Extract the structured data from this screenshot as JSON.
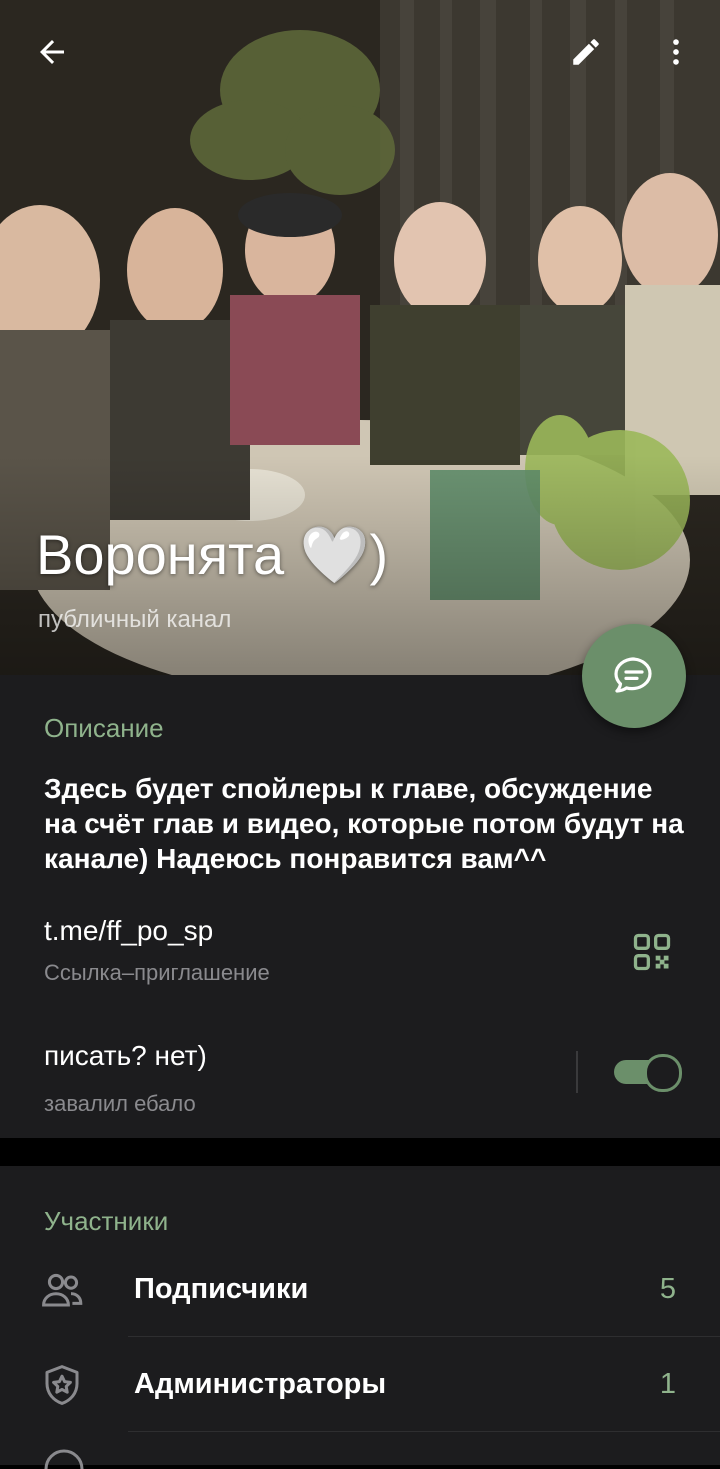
{
  "header": {
    "title": "Воронята 🤍)",
    "subtitle": "публичный канал",
    "back_icon": "arrow-left-icon",
    "edit_icon": "pencil-icon",
    "more_icon": "more-vertical-icon",
    "fab_icon": "chat-bubble-icon"
  },
  "info": {
    "description_header": "Описание",
    "description_text": "Здесь будет спойлеры к главе, обсуждение на счёт глав и видео, которые потом будут на канале) Надеюсь понравится вам^^",
    "link_text": "t.me/ff_po_sp",
    "link_sub": "Ссылка–приглашение",
    "link_icon": "qr-code-icon",
    "setting_title": "писать? нет)",
    "setting_sub": "завалил ебало",
    "setting_enabled": true
  },
  "members": {
    "header": "Участники",
    "items": [
      {
        "label": "Подписчики",
        "count": "5",
        "icon": "users-icon"
      },
      {
        "label": "Администраторы",
        "count": "1",
        "icon": "shield-star-icon"
      }
    ]
  },
  "colors": {
    "accent": "#8fb38c",
    "fab": "#6b8f6a",
    "card_bg": "#1c1c1e",
    "page_bg": "#000000"
  }
}
